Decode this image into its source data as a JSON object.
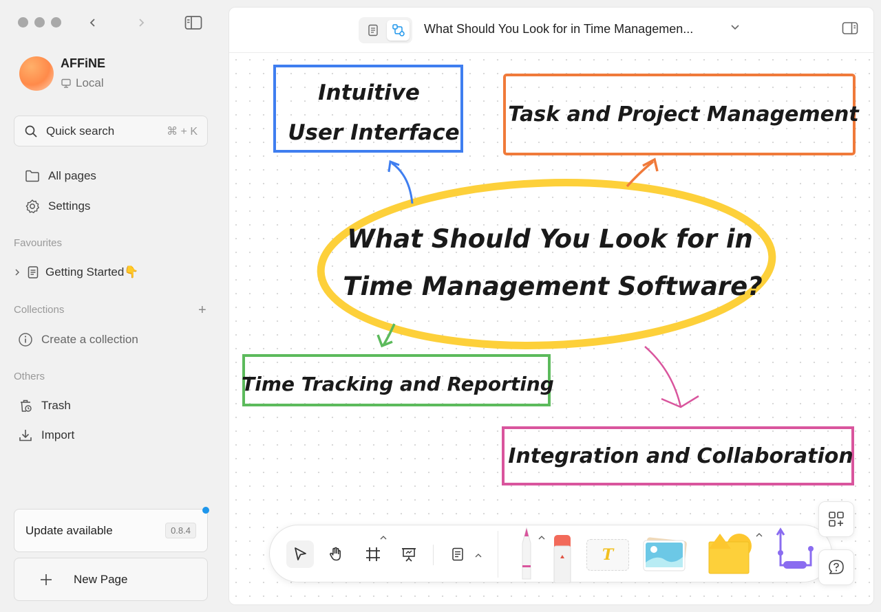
{
  "workspace": {
    "name": "AFFiNE",
    "storage": "Local"
  },
  "search": {
    "label": "Quick search",
    "shortcut": "⌘ + K"
  },
  "nav": {
    "all_pages": "All pages",
    "settings": "Settings"
  },
  "favourites": {
    "label": "Favourites",
    "items": [
      {
        "label": "Getting Started👇"
      }
    ]
  },
  "collections": {
    "label": "Collections",
    "create": "Create a collection"
  },
  "others": {
    "label": "Others",
    "trash": "Trash",
    "import": "Import"
  },
  "update": {
    "label": "Update available",
    "version": "0.8.4"
  },
  "new_page": {
    "label": "New Page"
  },
  "header": {
    "title": "What Should You Look for in Time Managemen..."
  },
  "canvas": {
    "center_line1": "What Should You Look for in",
    "center_line2": "Time Management Software?",
    "node_ui_line1": "Intuitive",
    "node_ui_line2": "User Interface",
    "node_task": "Task and Project Management",
    "node_time": "Time Tracking and Reporting",
    "node_integration": "Integration and Collaboration",
    "text_tool": "T"
  },
  "colors": {
    "blue": "#3f7ef0",
    "orange": "#f07a3a",
    "yellow": "#fdd03a",
    "green": "#5cba5c",
    "pink": "#d9559d",
    "accent": "#1e96eb"
  }
}
